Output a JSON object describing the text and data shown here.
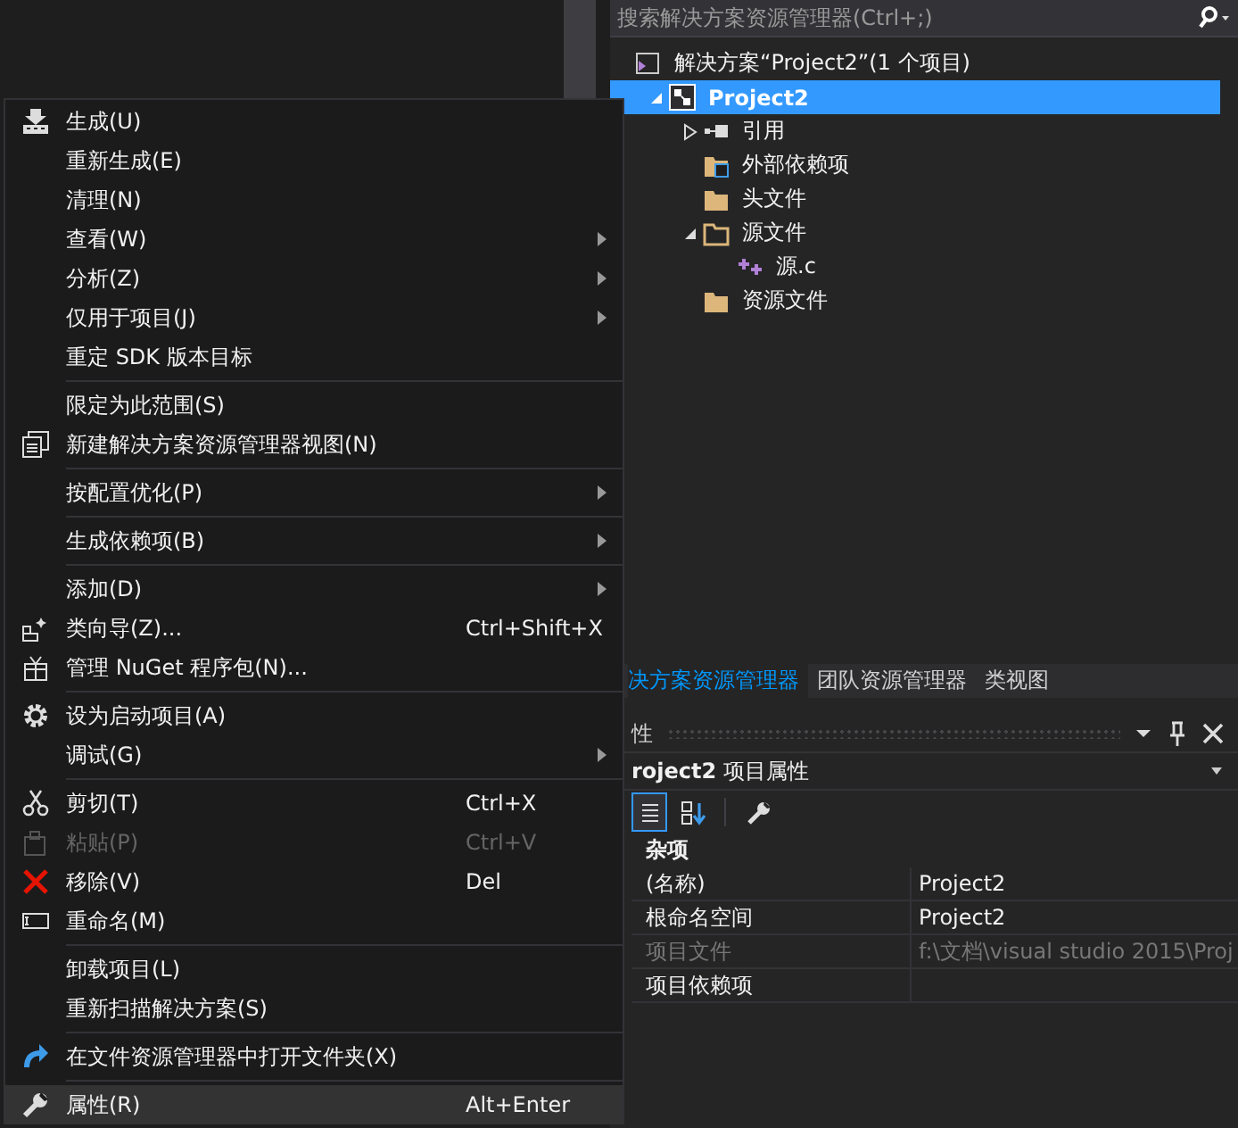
{
  "search": {
    "placeholder": "搜索解决方案资源管理器(Ctrl+;)"
  },
  "tree": [
    {
      "label": "解决方案“Project2”(1 个项目)",
      "selected": false,
      "children": [
        {
          "label": "Project2",
          "selected": true,
          "expanded": true,
          "children": [
            {
              "label": "引用",
              "selected": false,
              "expanded": false
            },
            {
              "label": "外部依赖项",
              "selected": false
            },
            {
              "label": "头文件",
              "selected": false
            },
            {
              "label": "源文件",
              "selected": false,
              "expanded": true,
              "children": [
                {
                  "label": "源.c",
                  "selected": false
                }
              ]
            },
            {
              "label": "资源文件",
              "selected": false
            }
          ]
        }
      ]
    }
  ],
  "panel_tabs": [
    {
      "label": "决方案资源管理器",
      "selected": true
    },
    {
      "label": "团队资源管理器",
      "selected": false
    },
    {
      "label": "类视图",
      "selected": false
    }
  ],
  "properties": {
    "title": "性",
    "object": "**roject2** 项目属性",
    "toolbar": [
      {
        "selected": true
      },
      {
        "selected": false
      },
      {
        "selected": false
      }
    ],
    "category": "杂项",
    "rows": [
      {
        "name": "(名称)",
        "value": "Project2",
        "disabled": false
      },
      {
        "name": "根命名空间",
        "value": "Project2",
        "disabled": false
      },
      {
        "name": "项目文件",
        "value": "f:\\文档\\visual studio 2015\\Proj",
        "disabled": true
      },
      {
        "name": "项目依赖项",
        "disabled": false
      }
    ]
  },
  "context_menu": [
    [
      {
        "label": "生成(U)",
        "selected": false
      },
      {
        "label": "重新生成(E)",
        "selected": false
      },
      {
        "label": "清理(N)",
        "selected": false
      },
      {
        "label": "查看(W)",
        "submenu": true,
        "selected": false
      },
      {
        "label": "分析(Z)",
        "submenu": true,
        "selected": false
      },
      {
        "label": "仅用于项目(J)",
        "submenu": true,
        "selected": false
      },
      {
        "label": "重定 SDK 版本目标",
        "selected": false
      }
    ],
    [
      {
        "label": "限定为此范围(S)",
        "selected": false
      },
      {
        "label": "新建解决方案资源管理器视图(N)",
        "selected": false
      }
    ],
    [
      {
        "label": "按配置优化(P)",
        "submenu": true,
        "selected": false
      }
    ],
    [
      {
        "label": "生成依赖项(B)",
        "submenu": true,
        "selected": false
      }
    ],
    [
      {
        "label": "添加(D)",
        "submenu": true,
        "selected": false
      },
      {
        "label": "类向导(Z)...",
        "shortcut": "Ctrl+Shift+X",
        "selected": false
      },
      {
        "label": "管理 NuGet 程序包(N)...",
        "selected": false
      }
    ],
    [
      {
        "label": "设为启动项目(A)",
        "selected": false
      },
      {
        "label": "调试(G)",
        "submenu": true,
        "selected": false
      }
    ],
    [
      {
        "label": "剪切(T)",
        "shortcut": "Ctrl+X",
        "selected": false
      },
      {
        "label": "粘贴(P)",
        "shortcut": "Ctrl+V",
        "disabled": true,
        "selected": false
      },
      {
        "label": "移除(V)",
        "shortcut": "Del",
        "selected": false
      },
      {
        "label": "重命名(M)",
        "selected": false
      }
    ],
    [
      {
        "label": "卸载项目(L)",
        "selected": false
      },
      {
        "label": "重新扫描解决方案(S)",
        "selected": false
      }
    ],
    [
      {
        "label": "在文件资源管理器中打开文件夹(X)",
        "selected": false
      }
    ],
    [
      {
        "label": "属性(R)",
        "shortcut": "Alt+Enter",
        "selected": true
      }
    ]
  ]
}
